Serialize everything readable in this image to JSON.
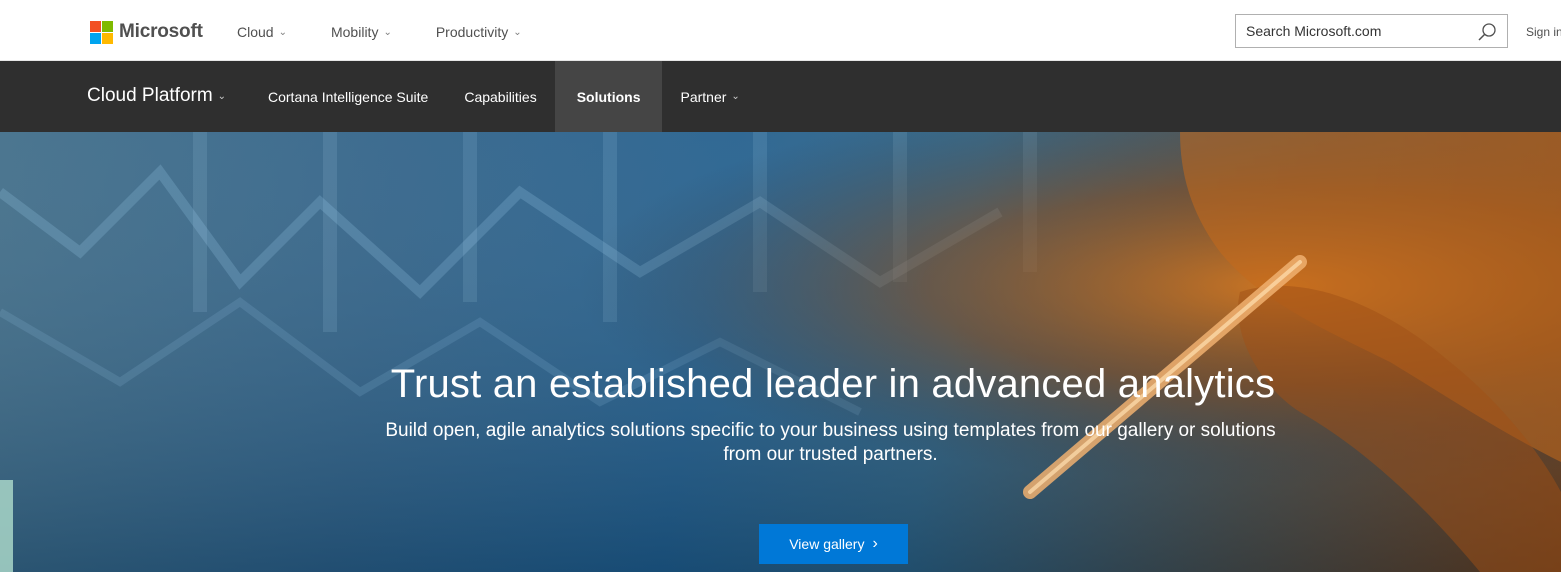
{
  "topbar": {
    "brand": "Microsoft",
    "nav": [
      {
        "label": "Cloud"
      },
      {
        "label": "Mobility"
      },
      {
        "label": "Productivity"
      }
    ],
    "search_placeholder": "Search Microsoft.com",
    "signin": "Sign in"
  },
  "subnav": {
    "platform": "Cloud Platform",
    "links": [
      {
        "label": "Cortana Intelligence Suite"
      },
      {
        "label": "Capabilities"
      },
      {
        "label": "Solutions"
      },
      {
        "label": "Partner"
      }
    ]
  },
  "hero": {
    "title": "Trust an established leader in advanced analytics",
    "subtitle_line1": "Build open, agile analytics solutions specific to your business using templates from our gallery or solutions",
    "subtitle_line2": "from our trusted partners.",
    "cta": "View gallery"
  },
  "colors": {
    "accent": "#0078d7",
    "subnav_bg": "#2f2f2f",
    "subnav_active": "#454545"
  },
  "icons": {
    "search": "search-icon",
    "chevron": "chevron-down-icon",
    "cta_arrow": "chevron-right-icon"
  }
}
